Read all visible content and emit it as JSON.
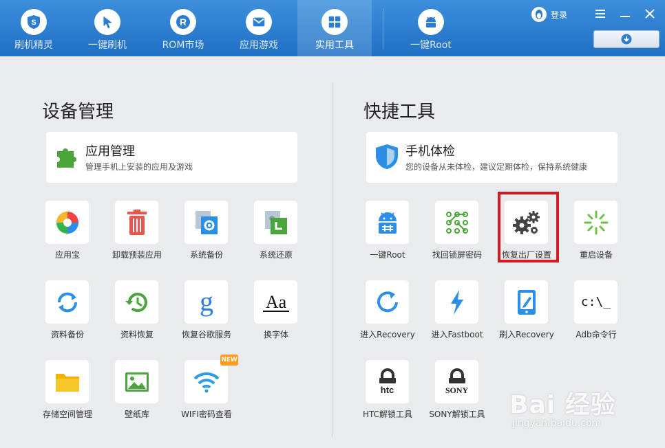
{
  "topbar": {
    "tabs": [
      {
        "label": "刷机精灵",
        "icon": "shield-s-icon"
      },
      {
        "label": "一键刷机",
        "icon": "cursor-icon"
      },
      {
        "label": "ROM市场",
        "icon": "r-logo-icon"
      },
      {
        "label": "应用游戏",
        "icon": "mail-icon"
      },
      {
        "label": "实用工具",
        "icon": "grid-icon",
        "active": true
      },
      {
        "label": "一键Root",
        "icon": "android-icon"
      }
    ],
    "login_label": "登录",
    "colors": {
      "bar": "#2a7dd2",
      "accent": "#ffffff"
    }
  },
  "left": {
    "title": "设备管理",
    "card": {
      "title": "应用管理",
      "desc": "管理手机上安装的应用及游戏",
      "icon": "puzzle-icon"
    },
    "tools": [
      {
        "label": "应用宝",
        "icon": "yingyongbao-icon"
      },
      {
        "label": "卸载预装应用",
        "icon": "trash-icon"
      },
      {
        "label": "系统备份",
        "icon": "system-backup-icon"
      },
      {
        "label": "系统还原",
        "icon": "system-restore-icon"
      },
      {
        "label": "资料备份",
        "icon": "sync-icon"
      },
      {
        "label": "资料恢复",
        "icon": "history-icon"
      },
      {
        "label": "恢复谷歌服务",
        "icon": "google-g-icon"
      },
      {
        "label": "换字体",
        "icon": "font-aa-icon"
      },
      {
        "label": "存储空间管理",
        "icon": "folder-icon"
      },
      {
        "label": "壁纸库",
        "icon": "image-icon"
      },
      {
        "label": "WIFI密码查看",
        "icon": "wifi-icon"
      }
    ],
    "badge": "NEW"
  },
  "right": {
    "title": "快捷工具",
    "card": {
      "title": "手机体检",
      "desc": "您的设备从未体检，建议定期体检，保持系统健康",
      "icon": "shield-check-icon"
    },
    "tools": [
      {
        "label": "一键Root",
        "icon": "android-root-icon"
      },
      {
        "label": "找回锁屏密码",
        "icon": "pattern-lock-icon"
      },
      {
        "label": "恢复出厂设置",
        "icon": "gears-icon"
      },
      {
        "label": "重启设备",
        "icon": "restart-icon"
      },
      {
        "label": "进入Recovery",
        "icon": "recovery-icon"
      },
      {
        "label": "进入Fastboot",
        "icon": "lightning-icon"
      },
      {
        "label": "刷入Recovery",
        "icon": "tablet-edit-icon"
      },
      {
        "label": "Adb命令行",
        "icon": "terminal-icon"
      },
      {
        "label": "HTC解锁工具",
        "icon": "htc-lock-icon"
      },
      {
        "label": "SONY解锁工具",
        "icon": "sony-lock-icon"
      }
    ],
    "terminal_text": "c:\\_",
    "htc_text": "htc",
    "sony_text": "SONY"
  },
  "watermark": {
    "brand": "Bai 经验",
    "url": "jingyan.baidu.com"
  }
}
